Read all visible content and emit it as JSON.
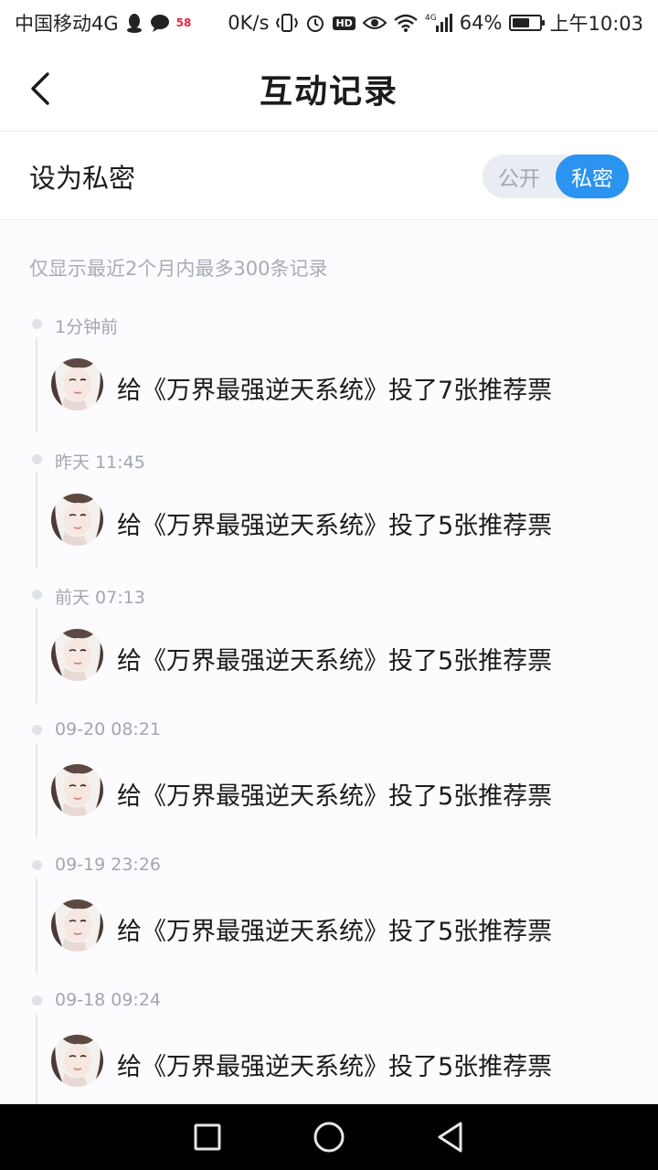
{
  "status_bar": {
    "carrier": "中国移动4G",
    "badge": "58",
    "network_speed": "0K/s",
    "hd_label": "HD",
    "signal_label": "4G",
    "battery_percent": "64%",
    "battery_level": 0.64,
    "time": "上午10:03"
  },
  "header": {
    "title": "互动记录",
    "back_icon": "chevron-left-icon"
  },
  "privacy": {
    "label": "设为私密",
    "options": [
      "公开",
      "私密"
    ],
    "selected": "私密"
  },
  "note": "仅显示最近2个月内最多300条记录",
  "records": [
    {
      "time": "1分钟前",
      "text": "给《万界最强逆天系统》投了7张推荐票"
    },
    {
      "time": "昨天 11:45",
      "text": "给《万界最强逆天系统》投了5张推荐票"
    },
    {
      "time": "前天 07:13",
      "text": "给《万界最强逆天系统》投了5张推荐票"
    },
    {
      "time": "09-20 08:21",
      "text": "给《万界最强逆天系统》投了5张推荐票"
    },
    {
      "time": "09-19 23:26",
      "text": "给《万界最强逆天系统》投了5张推荐票"
    },
    {
      "time": "09-18 09:24",
      "text": "给《万界最强逆天系统》投了5张推荐票"
    }
  ],
  "system_nav": [
    "square-icon",
    "circle-icon",
    "triangle-back-icon"
  ],
  "colors": {
    "accent": "#2b93f0",
    "toggle_bg": "#e9ecf3",
    "muted_text": "#a2a6b0"
  }
}
